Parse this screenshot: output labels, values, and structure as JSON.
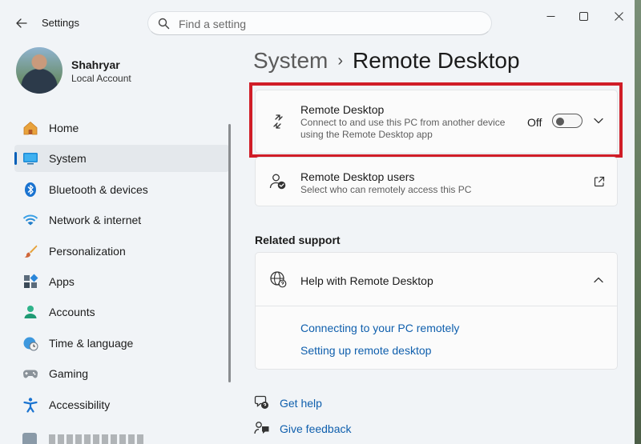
{
  "window": {
    "app_title": "Settings",
    "search_placeholder": "Find a setting"
  },
  "profile": {
    "name": "Shahryar",
    "account_type": "Local Account"
  },
  "sidebar": {
    "items": [
      {
        "label": "Home",
        "icon": "home-icon",
        "active": false
      },
      {
        "label": "System",
        "icon": "system-icon",
        "active": true
      },
      {
        "label": "Bluetooth & devices",
        "icon": "bluetooth-icon",
        "active": false
      },
      {
        "label": "Network & internet",
        "icon": "wifi-icon",
        "active": false
      },
      {
        "label": "Personalization",
        "icon": "brush-icon",
        "active": false
      },
      {
        "label": "Apps",
        "icon": "apps-icon",
        "active": false
      },
      {
        "label": "Accounts",
        "icon": "accounts-icon",
        "active": false
      },
      {
        "label": "Time & language",
        "icon": "clock-globe-icon",
        "active": false
      },
      {
        "label": "Gaming",
        "icon": "gamepad-icon",
        "active": false
      },
      {
        "label": "Accessibility",
        "icon": "accessibility-icon",
        "active": false
      }
    ]
  },
  "breadcrumb": {
    "parent": "System",
    "separator": "›",
    "current": "Remote Desktop"
  },
  "remote_desktop": {
    "title": "Remote Desktop",
    "description_line1": "Connect to and use this PC from another device",
    "description_line2": "using the Remote Desktop app",
    "toggle_state": "Off",
    "toggle_on": false
  },
  "remote_users": {
    "title": "Remote Desktop users",
    "description": "Select who can remotely access this PC"
  },
  "related_support": {
    "section_title": "Related support",
    "help_title": "Help with Remote Desktop",
    "links": [
      "Connecting to your PC remotely",
      "Setting up remote desktop"
    ]
  },
  "footer": {
    "get_help": "Get help",
    "give_feedback": "Give feedback"
  },
  "colors": {
    "accent": "#005fb8",
    "link": "#0f5fad",
    "highlight_box": "#d01d27"
  }
}
